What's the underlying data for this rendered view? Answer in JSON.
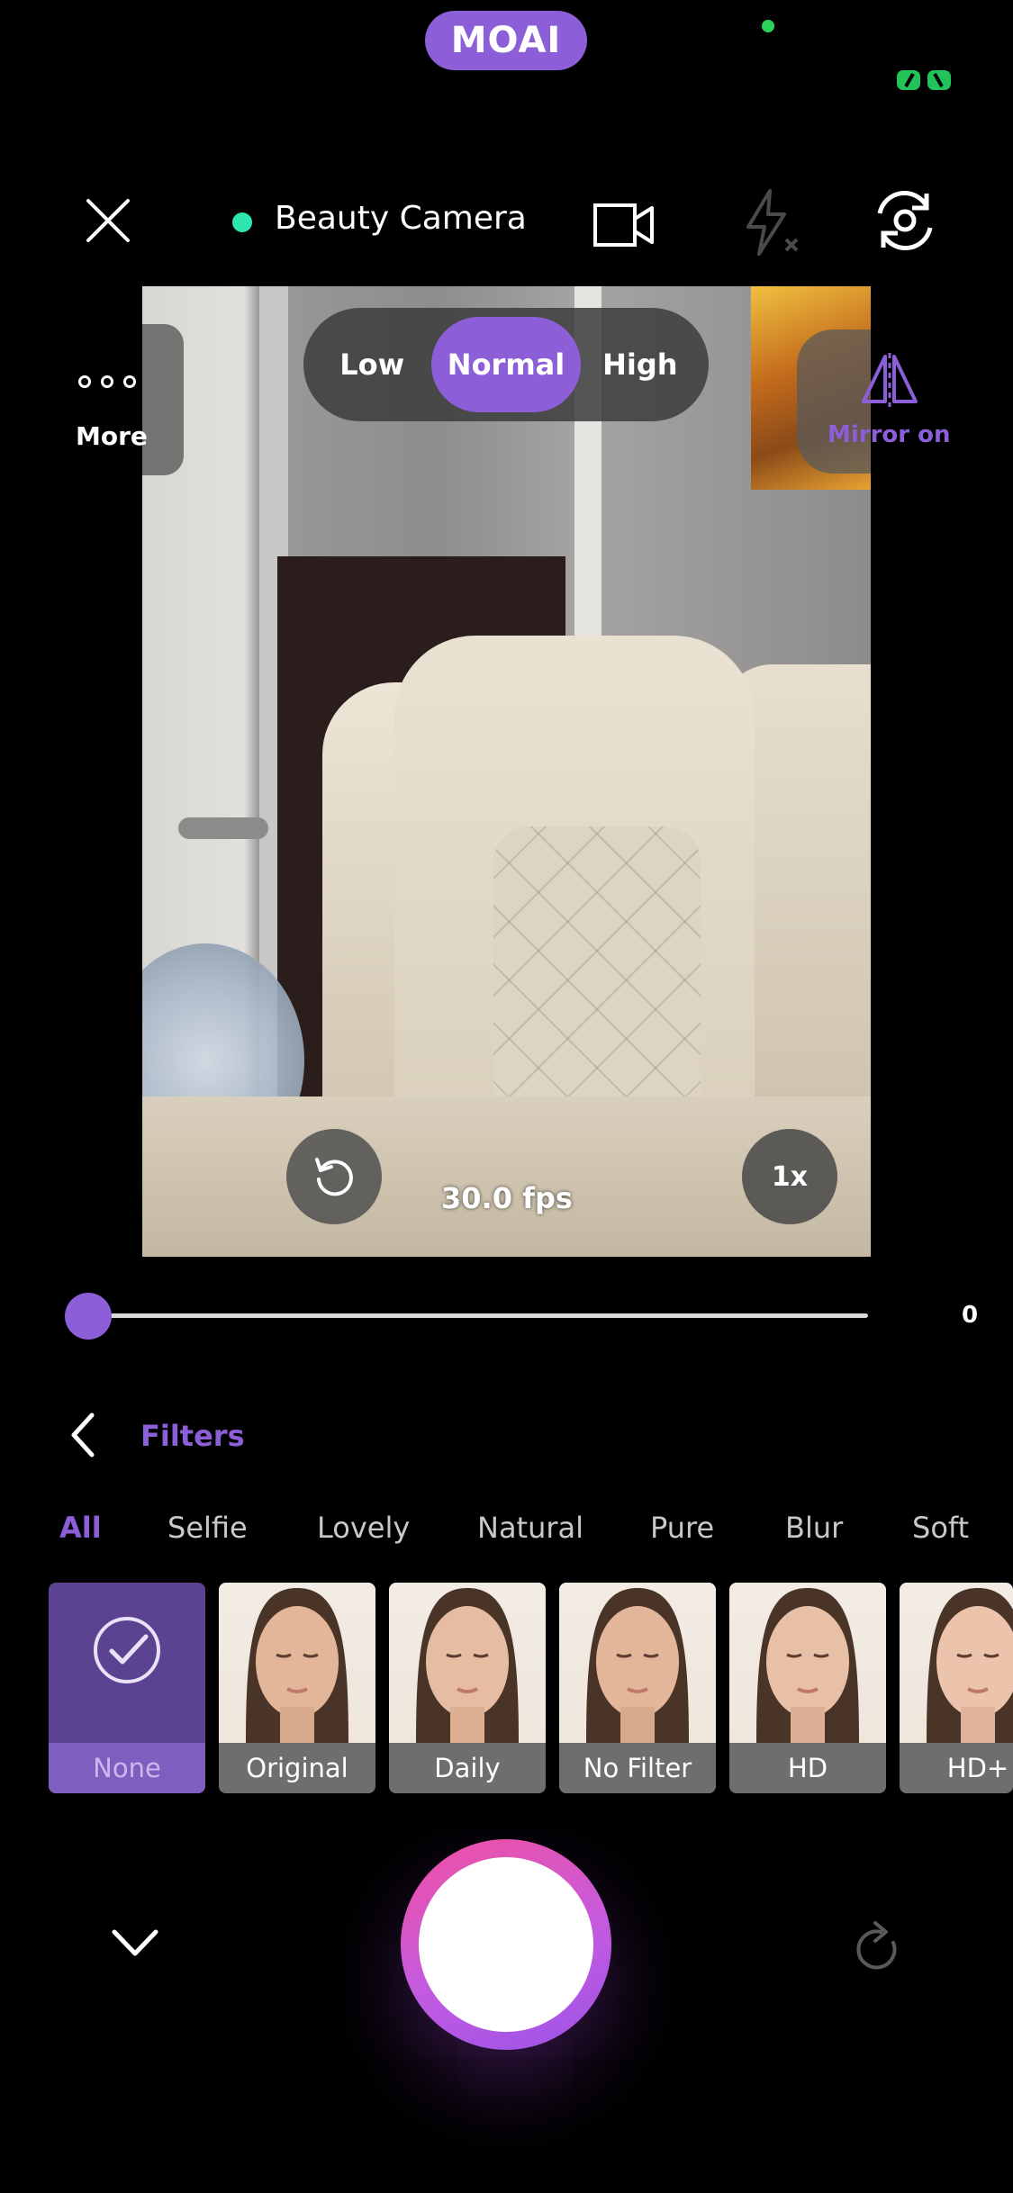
{
  "brand": {
    "label": "MOAI"
  },
  "top_bar": {
    "mode_title": "Beauty Camera",
    "icons": [
      "close-icon",
      "video-camera-icon",
      "flash-off-icon",
      "switch-camera-icon"
    ]
  },
  "intensity": {
    "options": [
      "Low",
      "Normal",
      "High"
    ],
    "selected": "Normal"
  },
  "side": {
    "more_label": "More",
    "mirror_label": "Mirror on"
  },
  "preview": {
    "fps": "30.0 fps",
    "zoom": "1x"
  },
  "slider": {
    "value": "0",
    "level": 0
  },
  "filters": {
    "title": "Filters",
    "categories": [
      "All",
      "Selfie",
      "Lovely",
      "Natural",
      "Pure",
      "Blur",
      "Soft"
    ],
    "active_category": "All",
    "items": [
      "None",
      "Original",
      "Daily",
      "No Filter",
      "HD",
      "HD+"
    ],
    "selected": "None"
  },
  "colors": {
    "accent": "#8c5ed8",
    "shutter_gradient_start": "#f24fa0",
    "shutter_gradient_end": "#9b52e8",
    "mode_dot": "#2ee6b0"
  }
}
